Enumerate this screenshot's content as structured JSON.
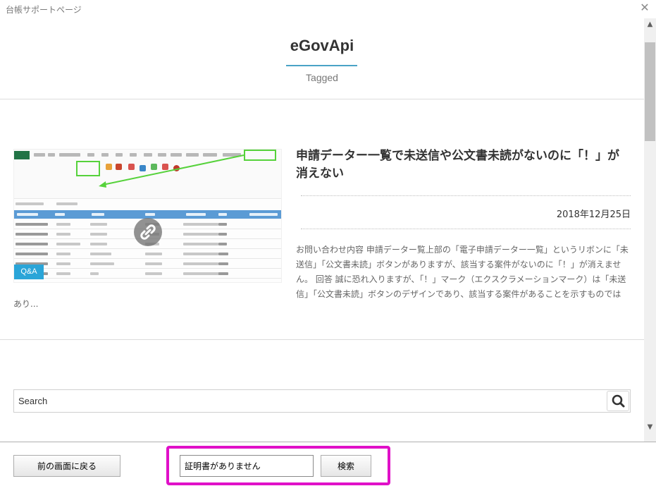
{
  "window": {
    "title": "台帳サポートページ",
    "close_glyph": "✕"
  },
  "page": {
    "title": "eGovApi",
    "subtitle": "Tagged"
  },
  "article": {
    "title": "申請データー一覧で未送信や公文書未読がないのに「！」が消えない",
    "date": "2018年12月25日",
    "excerpt": "お問い合わせ内容 申請データー覧上部の「電子申請データー一覧」というリボンに「未送信」「公文書未読」ボタンがありますが、該当する案件がないのに「！」が消えません。 回答 誠に恐れ入りますが、「！」マーク（エクスクラメーションマーク）は「未送信」「公文書未読」ボタンのデザインであり、該当する案件があることを示すものでは",
    "more": "あり...",
    "thumbnail_badge": "Q&A",
    "thumbnail_link_icon": "link-icon"
  },
  "search": {
    "placeholder": "Search",
    "icon": "search-icon"
  },
  "toolbar": {
    "back_label": "前の画面に戻る",
    "keyword_value": "証明書がありません",
    "find_label": "検索"
  },
  "colors": {
    "accent": "#4aa3c6",
    "highlight": "#e010c8",
    "qa_badge": "#2aa5d8",
    "callout_green": "#56d23b"
  }
}
